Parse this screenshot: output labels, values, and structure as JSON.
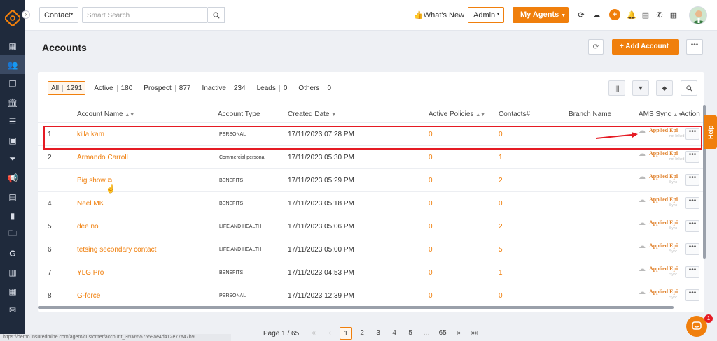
{
  "topbar": {
    "entity_selector": "Contact",
    "search_placeholder": "Smart Search",
    "whats_new": "What's New",
    "role_selector": "Admin",
    "agents_button": "My Agents",
    "icons": [
      "refresh-icon",
      "cloud-sync-icon",
      "plus-icon",
      "bell-icon",
      "notes-icon",
      "phone-icon",
      "apps-icon"
    ]
  },
  "sidebar": {
    "icons": [
      "dashboard-icon",
      "contacts-icon",
      "copy-icon",
      "institution-icon",
      "list-icon",
      "id-card-icon",
      "funnel-icon",
      "megaphone-icon",
      "document-icon",
      "chart-icon",
      "folder-icon",
      "google-icon",
      "file-icon",
      "calendar-icon",
      "mail-icon"
    ]
  },
  "page": {
    "title": "Accounts",
    "add_button": "+  Add Account"
  },
  "filters": [
    {
      "label": "All",
      "count": "1291"
    },
    {
      "label": "Active",
      "count": "180"
    },
    {
      "label": "Prospect",
      "count": "877"
    },
    {
      "label": "Inactive",
      "count": "234"
    },
    {
      "label": "Leads",
      "count": "0"
    },
    {
      "label": "Others",
      "count": "0"
    }
  ],
  "columns": {
    "name": "Account Name",
    "type": "Account Type",
    "created": "Created Date",
    "policies": "Active Policies",
    "contacts": "Contacts#",
    "branch": "Branch Name",
    "sync": "AMS Sync",
    "action": "Action"
  },
  "rows": [
    {
      "num": "1",
      "name": "killa kam",
      "type": "PERSONAL",
      "created": "17/11/2023 07:28 PM",
      "policies": "0",
      "contacts": "0",
      "sync": "Applied Epi",
      "sync_sub": "not linked"
    },
    {
      "num": "2",
      "name": "Armando Carroll",
      "type": "Commercial,personal",
      "created": "17/11/2023 05:30 PM",
      "policies": "0",
      "contacts": "1",
      "sync": "Applied Epi",
      "sync_sub": "not linked"
    },
    {
      "num": "",
      "name": "Big show",
      "type": "BENEFITS",
      "created": "17/11/2023 05:29 PM",
      "policies": "0",
      "contacts": "2",
      "sync": "Applied Epi",
      "sync_sub": "Sync"
    },
    {
      "num": "4",
      "name": "Neel MK",
      "type": "BENEFITS",
      "created": "17/11/2023 05:18 PM",
      "policies": "0",
      "contacts": "0",
      "sync": "Applied Epi",
      "sync_sub": "Sync"
    },
    {
      "num": "5",
      "name": "dee no",
      "type": "LIFE AND HEALTH",
      "created": "17/11/2023 05:06 PM",
      "policies": "0",
      "contacts": "2",
      "sync": "Applied Epi",
      "sync_sub": "Sync"
    },
    {
      "num": "6",
      "name": "tetsing secondary contact",
      "type": "LIFE AND HEALTH",
      "created": "17/11/2023 05:00 PM",
      "policies": "0",
      "contacts": "5",
      "sync": "Applied Epi",
      "sync_sub": "Sync"
    },
    {
      "num": "7",
      "name": "YLG Pro",
      "type": "BENEFITS",
      "created": "17/11/2023 04:53 PM",
      "policies": "0",
      "contacts": "1",
      "sync": "Applied Epi",
      "sync_sub": "Sync"
    },
    {
      "num": "8",
      "name": "G-force",
      "type": "PERSONAL",
      "created": "17/11/2023 12:39 PM",
      "policies": "0",
      "contacts": "0",
      "sync": "Applied Epi",
      "sync_sub": "Sync"
    }
  ],
  "pagination": {
    "label": "Page 1 / 65",
    "first": "«",
    "prev": "‹",
    "pages": [
      "1",
      "2",
      "3",
      "4",
      "5",
      "...",
      "65"
    ],
    "next": "»",
    "last": "»»"
  },
  "help_label": "Help",
  "chat_badge": "1",
  "status_url": "https://demo.insuredmine.com/agent/customer/account_360/6557559ae4d412e77a47b9",
  "colors": {
    "accent": "#f07f0c",
    "sidebar": "#1f2a3c",
    "highlight": "#e51b24"
  }
}
